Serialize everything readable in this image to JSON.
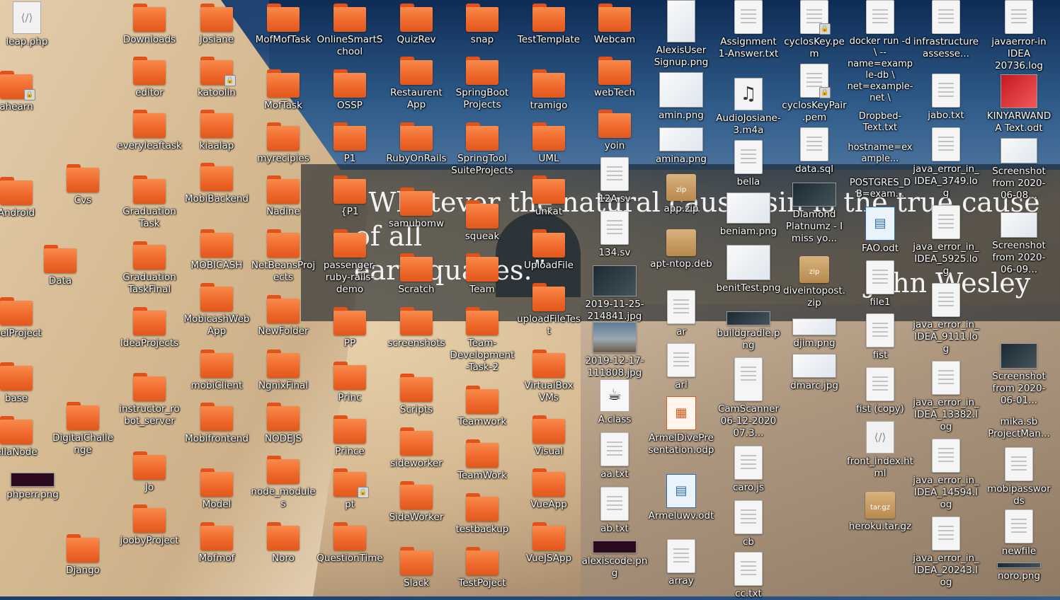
{
  "wallpaper": {
    "quote_line1": "“Whatever the natural cause, sin is the true cause of all",
    "quote_line2": "earthquakes.”",
    "author": "John Wesley"
  },
  "colors": {
    "folder": "#f06a2c",
    "folder_tab": "#e4521c",
    "label": "#ffffff"
  },
  "columns": {
    "col1": [
      "leap.php",
      "ahearn",
      "Android",
      "melProject",
      "base",
      "ellaNode",
      "phperr.png"
    ],
    "col2": [
      "Cvs",
      "Data",
      "DigitalChallenge",
      "Django"
    ],
    "col3": [
      "Downloads",
      "editor",
      "everyleaftask",
      "Graduation Task",
      "Graduation TaskFinal",
      "IdeaProjects",
      "instructor_robot_server",
      "Jo",
      "joobyProject"
    ],
    "col4": [
      "Josiane",
      "katoolin",
      "kiaalap",
      "MobiBackend",
      "MOBICASH",
      "MobicashWebApp",
      "mobiClient",
      "Mobifrontend",
      "Model",
      "Mofmof"
    ],
    "col5": [
      "MofMofTask",
      "MofTask",
      "myrecipies",
      "Nadine",
      "NetBeansProjects",
      "NewFolder",
      "NgnixFinal",
      "NODEJS",
      "node_modules",
      "Noro"
    ],
    "col6": [
      "OnlineSmartSchool",
      "OSSP",
      "P1",
      "{P1",
      "passenger-ruby-rails-demo",
      "PP",
      "Princ",
      "Prince",
      "pt",
      "QuestionTime"
    ],
    "col7": [
      "QuizRev",
      "Restaurent App",
      "RubyOnRails",
      "samuhomw",
      "Scratch",
      "screenshots",
      "Scripts",
      "sideworker",
      "SideWorker",
      "Slack"
    ],
    "col8": [
      "snap",
      "SpringBoot Projects",
      "SpringTool SuiteProjects",
      "squeak",
      "Team",
      "Team-Development-Task-2",
      "Teamwork",
      "TeamWork",
      "testbackup",
      "TestPoject"
    ],
    "col9": [
      "TestTemplate",
      "tramigo",
      "UML",
      "unkat",
      "UploadFile",
      "uploadFileTest",
      "VirtualBox VMs",
      "Visual",
      "VueApp",
      "VueJSApp"
    ],
    "col10": [
      "Webcam",
      "webTech",
      "yoin",
      "12A.sv",
      "134.sv",
      "2019-11-25-214841.jpg",
      "2019-12-17-111808.jpg",
      "A.class",
      "aa.txt",
      "ab.txt",
      "alexiscode.png"
    ],
    "col11": [
      "AlexisUser Signup.png",
      "amin.png",
      "amina.png",
      "app.zip",
      "apt-ntop.deb",
      "ar",
      "arl",
      "ArmelDivePresentation.odp",
      "Armeluwv.odt",
      "array"
    ],
    "col12": [
      "Assignment 1-Answer.txt",
      "AudioJosiane-3.m4a",
      "bella",
      "beniam.png",
      "benitTest.png",
      "buildgradle.png",
      "CamScanner 06-12-2020 07.3...",
      "caro.js",
      "cb",
      "cc.txt"
    ],
    "col13": [
      "cyclosKey.pem",
      "cyclosKeyPair.pem",
      "data.sql",
      "Diamond Platnumz - I miss yo...",
      "diveintopost.zip",
      "djim.png",
      "dmarc.jpg"
    ],
    "col14": [
      "docker run -d \\ --name=example-db \\ net=example-net \\",
      "Dropbed-Text.txt",
      "hostname=example...",
      "POSTGRES_DB=exam...",
      "FAO.odt",
      "file1",
      "fist",
      "fist (copy)",
      "front_index.html",
      "heroku.tar.gz"
    ],
    "col15": [
      "infrastructure assesse...",
      "jabo.txt",
      "java_error_in_IDEA_3749.log",
      "java_error_in_IDEA_5925.log",
      "java_error_in_IDEA_9111.log",
      "java_error_in_IDEA_13382.log",
      "java_error_in_IDEA_14594.log",
      "java_error_in_IDEA_20243.log"
    ],
    "col16": [
      "javaerror-in IDEA 20736.log",
      "KINYARWANDA Text.odt",
      "Screenshot from 2020-06-08...",
      "Screenshot from 2020-06-09...",
      "Screenshot from 2020-06-01...",
      "mika.sb ProjectMan...",
      "mobipasswords",
      "newfile",
      "noro.png"
    ]
  }
}
